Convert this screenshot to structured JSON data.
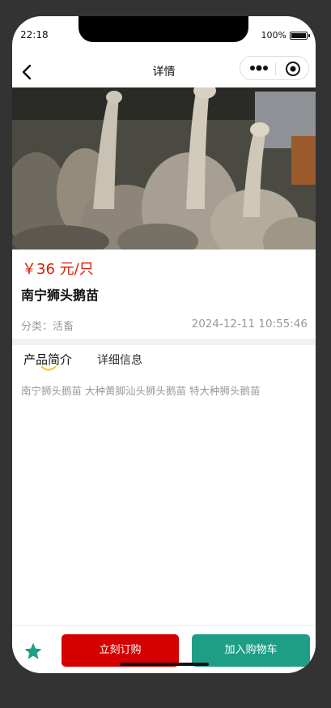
{
  "status_bar": {
    "time": "22:18",
    "battery": "100%"
  },
  "navbar": {
    "title": "详情"
  },
  "product": {
    "price": "￥36 元/只",
    "name": "南宁狮头鹅苗",
    "category": "分类：活畜",
    "date": "2024-12-11 10:55:46",
    "image_icon": "goose-photo"
  },
  "tabs": {
    "intro": "产品简介",
    "detail": "详细信息"
  },
  "intro_text": "南宁狮头鹅苗 大种黄脚汕头狮头鹅苗 特大种狮头鹅苗",
  "actions": {
    "order_label": "立刻订购",
    "cart_label": "加入购物车"
  },
  "colors": {
    "price": "#d81e06",
    "order": "#d50000",
    "cart": "#1f9e86",
    "star": "#1f9e86"
  }
}
